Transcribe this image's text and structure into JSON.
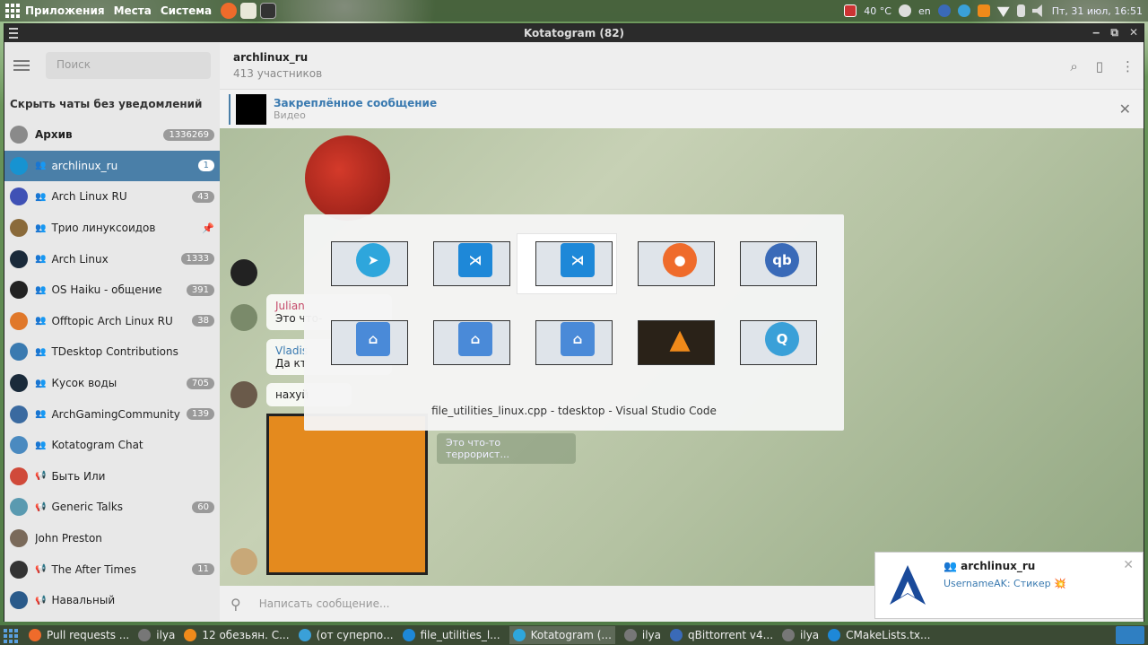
{
  "top_panel": {
    "menus": [
      "Приложения",
      "Места",
      "Система"
    ],
    "temperature": "40 °C",
    "layout": "en",
    "datetime": "Пт, 31 июл, 16:51"
  },
  "window": {
    "title": "Kotatogram (82)",
    "buttons": [
      "‒",
      "⧉",
      "✕"
    ]
  },
  "sidebar": {
    "search_placeholder": "Поиск",
    "hide_label": "Скрыть чаты без уведомлений",
    "chats": [
      {
        "name": "Архив",
        "badge": "1336269",
        "kind": "",
        "color": "#8a8a8a",
        "archive": true
      },
      {
        "name": "archlinux_ru",
        "badge": "1",
        "kind": "group",
        "color": "#1793d1",
        "active": true
      },
      {
        "name": "Arch Linux RU",
        "badge": "43",
        "kind": "group",
        "color": "#3f51b5"
      },
      {
        "name": "Трио линуксоидов",
        "badge": "",
        "kind": "group",
        "color": "#8a6a3a",
        "pinned": true
      },
      {
        "name": "Arch Linux",
        "badge": "1333",
        "kind": "group",
        "color": "#1a2a3a"
      },
      {
        "name": "OS Haiku - общение",
        "badge": "391",
        "kind": "group",
        "color": "#222222"
      },
      {
        "name": "Offtopic Arch Linux RU",
        "badge": "38",
        "kind": "group",
        "color": "#e0782a"
      },
      {
        "name": "TDesktop Contributions",
        "badge": "",
        "kind": "group",
        "color": "#3a7ab0"
      },
      {
        "name": "Кусок воды",
        "badge": "705",
        "kind": "group",
        "color": "#1a2a3a"
      },
      {
        "name": "ArchGamingCommunity",
        "badge": "139",
        "kind": "group",
        "color": "#3a6aa0"
      },
      {
        "name": "Kotatogram Chat",
        "badge": "",
        "kind": "group",
        "color": "#4a8ac0"
      },
      {
        "name": "Быть Или",
        "badge": "",
        "kind": "channel",
        "color": "#d04a3a"
      },
      {
        "name": "Generic Talks",
        "badge": "60",
        "kind": "channel",
        "color": "#5a9ab0"
      },
      {
        "name": "John Preston",
        "badge": "",
        "kind": "",
        "color": "#7a6a5a"
      },
      {
        "name": "The After Times",
        "badge": "11",
        "kind": "channel",
        "color": "#333333"
      },
      {
        "name": "Навальный",
        "badge": "",
        "kind": "channel",
        "color": "#2a5a8a"
      }
    ]
  },
  "chat": {
    "title": "archlinux_ru",
    "subtitle": "413 участников",
    "pinned_title": "Закреплённое сообщение",
    "pinned_sub": "Видео",
    "messages": [
      {
        "from": "Julian",
        "text": "Это что-"
      },
      {
        "from": "Vladis",
        "text": "Да кт"
      },
      {
        "from": "",
        "text": "нахуй"
      }
    ],
    "reply_text": "Это что-то террорист...",
    "compose_placeholder": "Написать сообщение..."
  },
  "switcher": {
    "caption": "file_utilities_linux.cpp - tdesktop - Visual Studio Code",
    "items": [
      {
        "icon": "telegram-icon",
        "color": "#2ea6dc",
        "glyph": "➤"
      },
      {
        "icon": "vscode-icon",
        "color": "#1e88d8",
        "glyph": "⋊"
      },
      {
        "icon": "vscode-icon",
        "color": "#1e88d8",
        "glyph": "⋊",
        "selected": true
      },
      {
        "icon": "firefox-icon",
        "color": "#ef6b2b",
        "glyph": "●"
      },
      {
        "icon": "qbittorrent-icon",
        "color": "#3a6ab8",
        "glyph": "qb"
      },
      {
        "icon": "folder-icon",
        "color": "#4a8ad8",
        "glyph": "⌂"
      },
      {
        "icon": "folder-icon",
        "color": "#4a8ad8",
        "glyph": "⌂"
      },
      {
        "icon": "folder-icon",
        "color": "#4a8ad8",
        "glyph": "⌂"
      },
      {
        "icon": "vlc-icon",
        "color": "#f08a1a",
        "glyph": "▲"
      },
      {
        "icon": "qtcreator-icon",
        "color": "#3aa0d8",
        "glyph": "Q"
      }
    ]
  },
  "notification": {
    "title": "archlinux_ru",
    "message": "UsernameAK: Стикер 💥"
  },
  "taskbar": {
    "items": [
      {
        "label": "Pull requests ...",
        "color": "#ef6b2b"
      },
      {
        "label": "ilya",
        "color": "#777777"
      },
      {
        "label": "12 обезьян. С...",
        "color": "#f08a1a"
      },
      {
        "label": "(от суперпо...",
        "color": "#3aa0d8"
      },
      {
        "label": "file_utilities_l...",
        "color": "#1e88d8"
      },
      {
        "label": "Kotatogram (...",
        "color": "#2ea6dc",
        "active": true
      },
      {
        "label": "ilya",
        "color": "#777777"
      },
      {
        "label": "qBittorrent v4...",
        "color": "#3a6ab8"
      },
      {
        "label": "ilya",
        "color": "#777777"
      },
      {
        "label": "CMakeLists.tx...",
        "color": "#1e88d8"
      }
    ]
  }
}
